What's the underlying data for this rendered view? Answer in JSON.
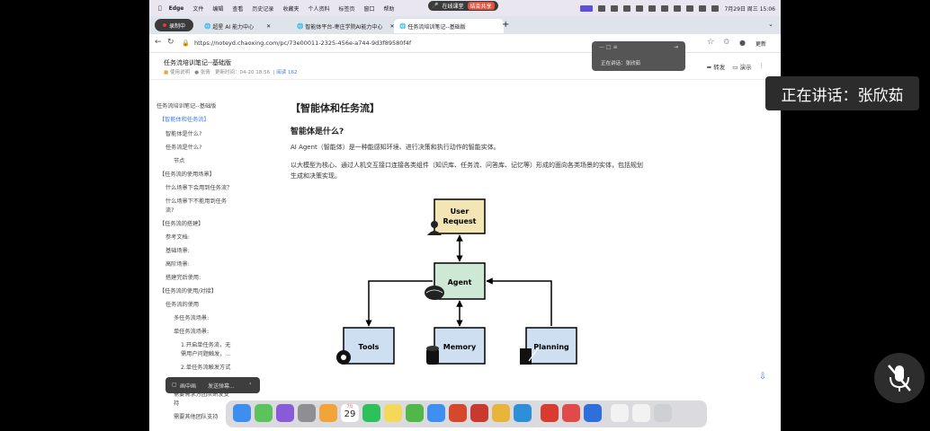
{
  "menubar": {
    "app": "Edge",
    "items": [
      "文件",
      "编辑",
      "查看",
      "历史记录",
      "收藏夹",
      "个人资料",
      "标签页",
      "窗口",
      "帮助"
    ],
    "clock": "7月29日 周三 15:06"
  },
  "recording": {
    "label": "录制中",
    "online_label": "在线课堂",
    "share_label": "结束共享"
  },
  "tabs": [
    {
      "label": "超星 AI 能力中心"
    },
    {
      "label": "智能体平台-枣庄学院AI能力中心"
    },
    {
      "label": "任务流培训笔记--基础版"
    }
  ],
  "address": {
    "url": "https://noteyd.chaoxing.com/pc/73e00011-2325-456e-a744-9d3f89580f4f",
    "more": "更新"
  },
  "doc": {
    "title": "任务流培训笔记--基础版",
    "folder": "使用说明",
    "author": "张倩",
    "updated": "更新时间：04-20 18:56",
    "views": "阅读 162",
    "forward": "转发",
    "present": "演示"
  },
  "speaker_popup": {
    "label": "正在讲话：张欣茹"
  },
  "speaker_overlay": "正在讲话：张欣茹",
  "toc": [
    "任务流培训笔记--基础版",
    "【智能体和任务流】",
    "智能体是什么?",
    "任务流是什么?",
    "节点",
    "【任务流的使用场景】",
    "什么场景下会用到任务流？",
    "什么场景下不能用到任务",
    "流?",
    "【任务流的搭建】",
    "参考文档:",
    "基础场景:",
    "高阶场景:",
    "搭建完后使用:",
    "【任务流的使用/对接】",
    "任务流的使用",
    "多任务流场景:",
    "单任务流场景:",
    "1.开启单任务流，无",
    "需用户问题触发，...",
    "2.单任务流触发方式",
    "需要需求方团队研发支",
    "持",
    "需要其他团队支持"
  ],
  "content": {
    "h1": "【智能体和任务流】",
    "h2": "智能体是什么?",
    "p1": "AI Agent（智能体）是一种能感知环境、进行决策和执行动作的智能实体。",
    "p2": "以大模型为核心、通过人机交互接口连接各类组件（知识库、任务流、问答库、记忆等）形成的面向各类场景的实体，包括规划生成和决策实现。"
  },
  "diagram": {
    "user": [
      "User",
      "Request"
    ],
    "agent": "Agent",
    "tools": "Tools",
    "memory": "Memory",
    "planning": "Planning",
    "colors": {
      "user": "#f3e6b4",
      "agent": "#cde8d4",
      "leaf": "#cfdff2"
    }
  },
  "bottom_tool": {
    "a": "画中画",
    "b": "发送弹幕..."
  },
  "dock": {
    "calendar_day": "29",
    "calendar_month": "7月"
  }
}
